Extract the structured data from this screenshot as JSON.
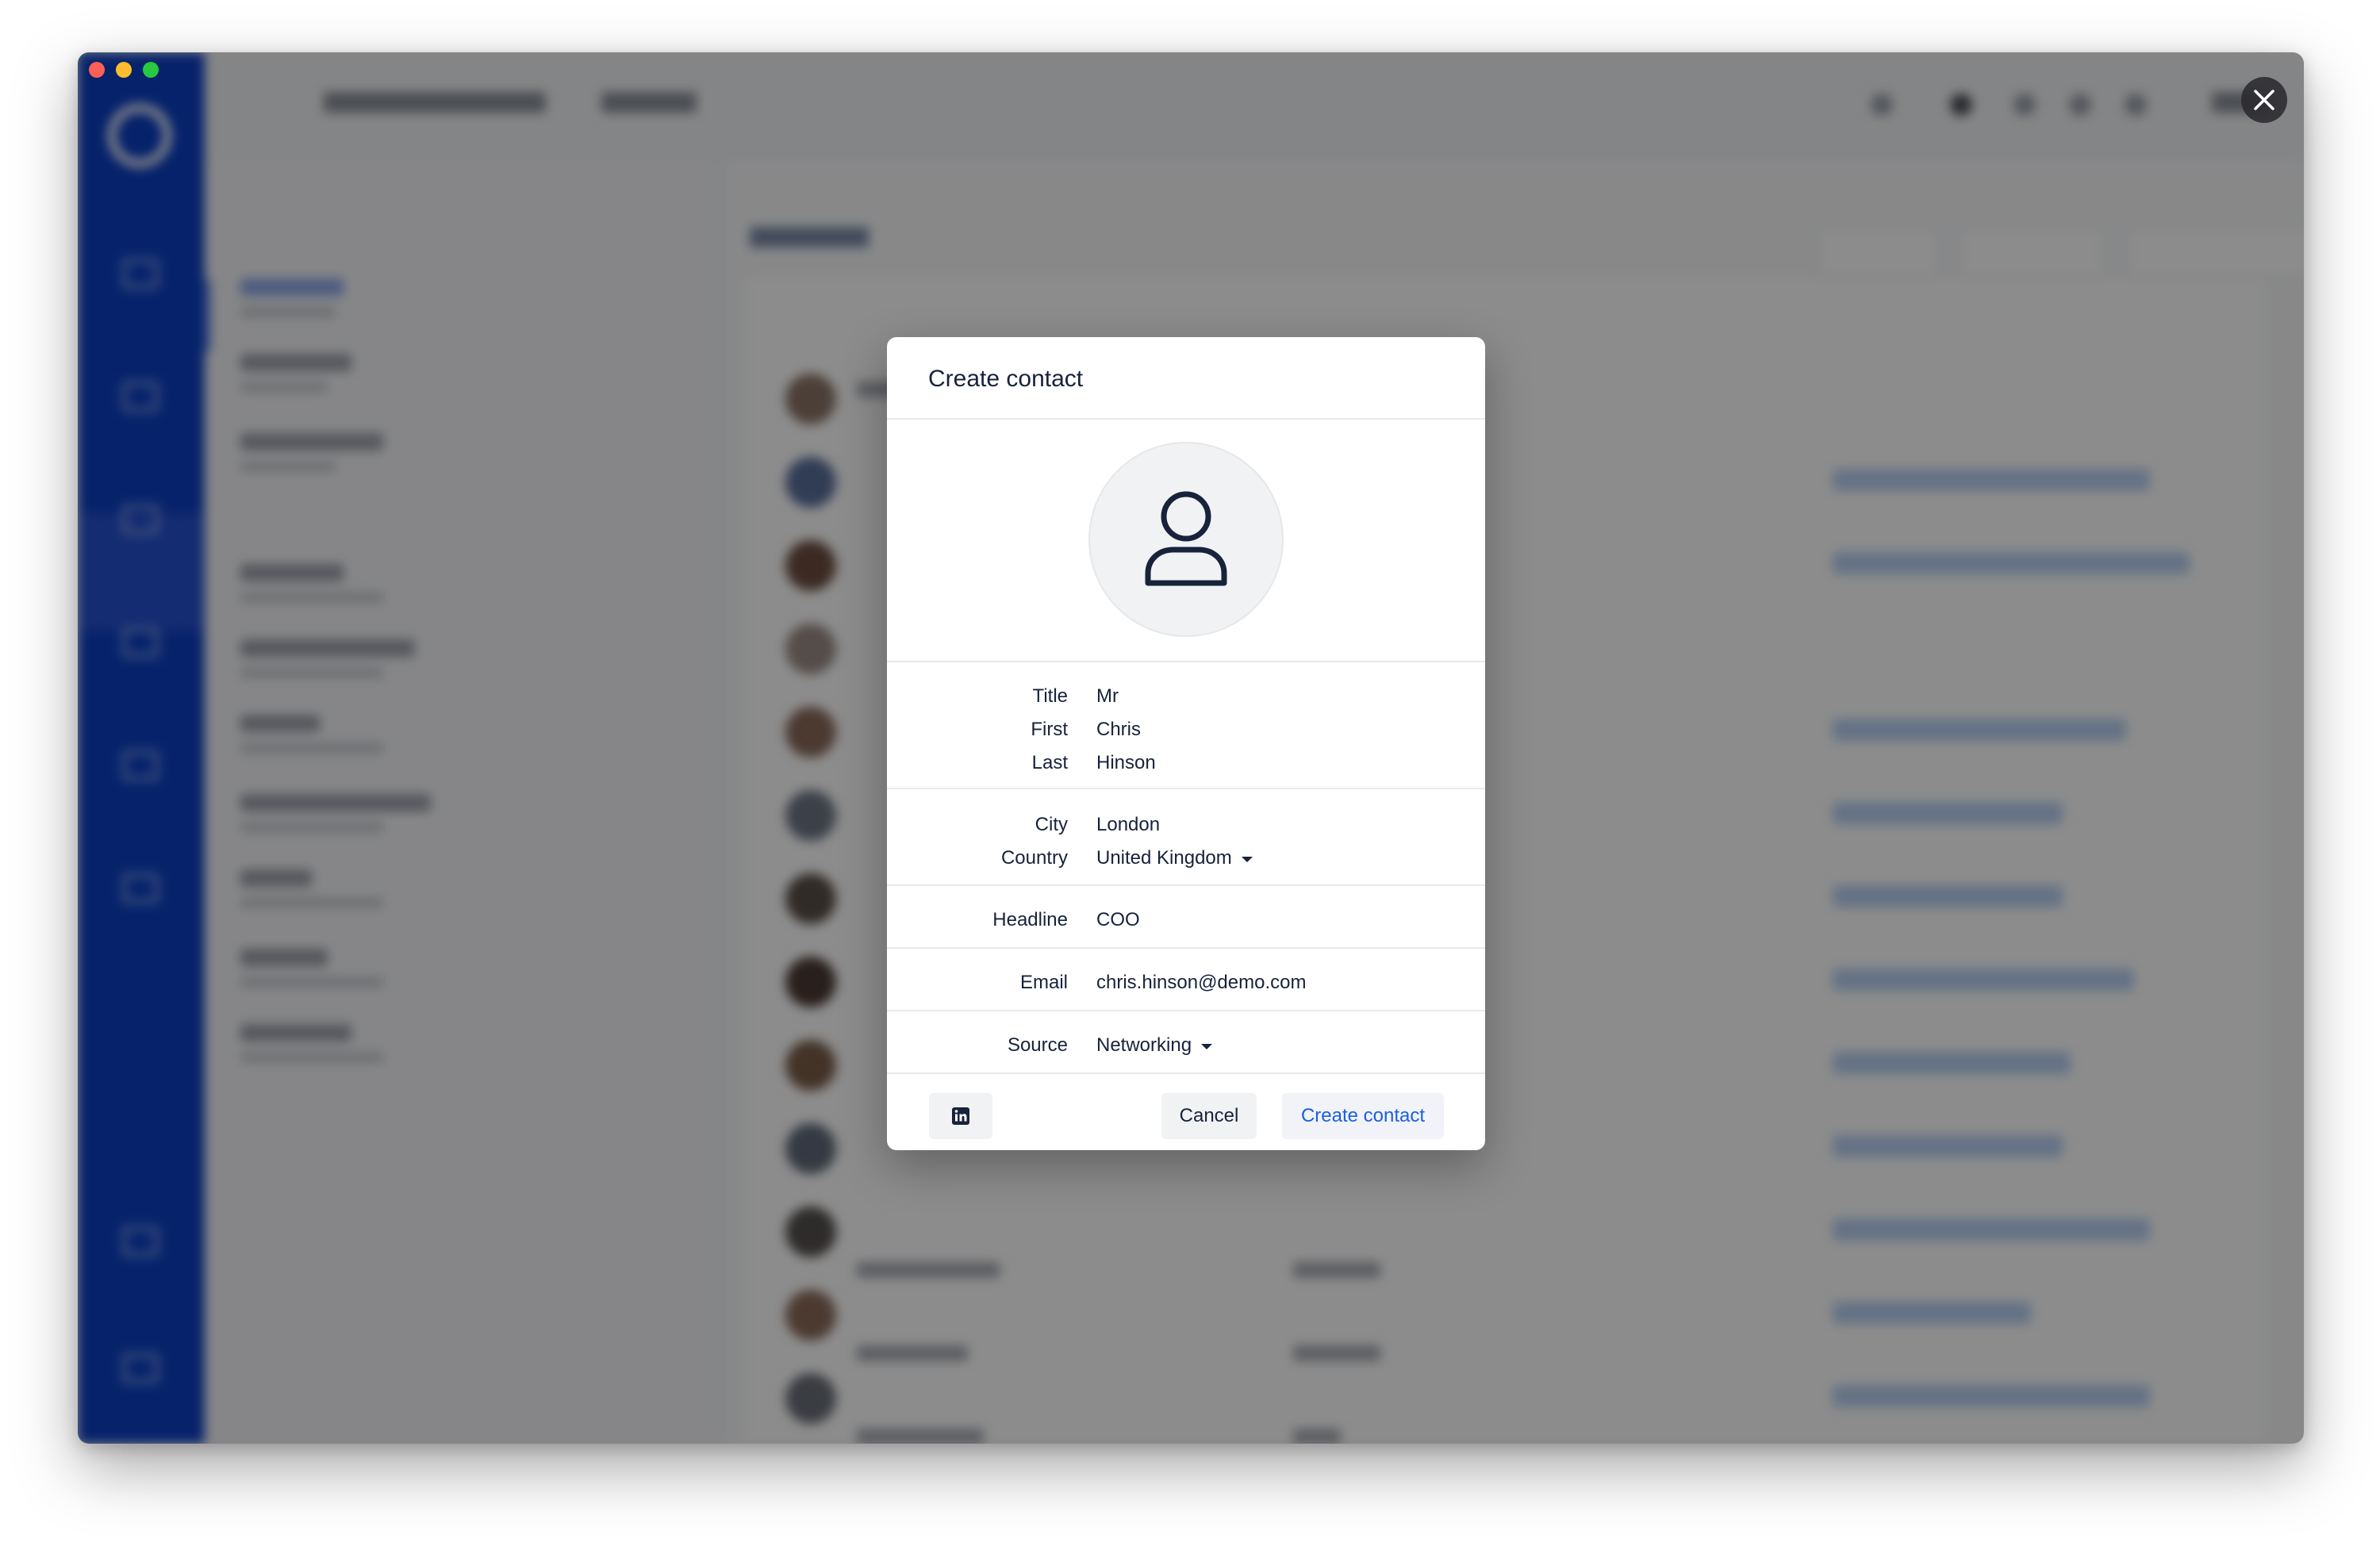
{
  "modal": {
    "title": "Create contact",
    "avatar_icon": "person-icon",
    "fields": {
      "title": {
        "label": "Title",
        "value": "Mr"
      },
      "first": {
        "label": "First",
        "value": "Chris"
      },
      "last": {
        "label": "Last",
        "value": "Hinson"
      },
      "city": {
        "label": "City",
        "value": "London"
      },
      "country": {
        "label": "Country",
        "value": "United Kingdom"
      },
      "headline": {
        "label": "Headline",
        "value": "COO"
      },
      "email": {
        "label": "Email",
        "value": "chris.hinson@demo.com"
      },
      "source": {
        "label": "Source",
        "value": "Networking"
      }
    },
    "footer": {
      "linkedin_icon": "linkedin-icon",
      "cancel_label": "Cancel",
      "create_label": "Create contact"
    }
  },
  "window": {
    "close_icon": "close-icon"
  },
  "colors": {
    "sidebar": "#0b3fc3",
    "accent": "#1b5ee0",
    "text": "#17223b"
  }
}
